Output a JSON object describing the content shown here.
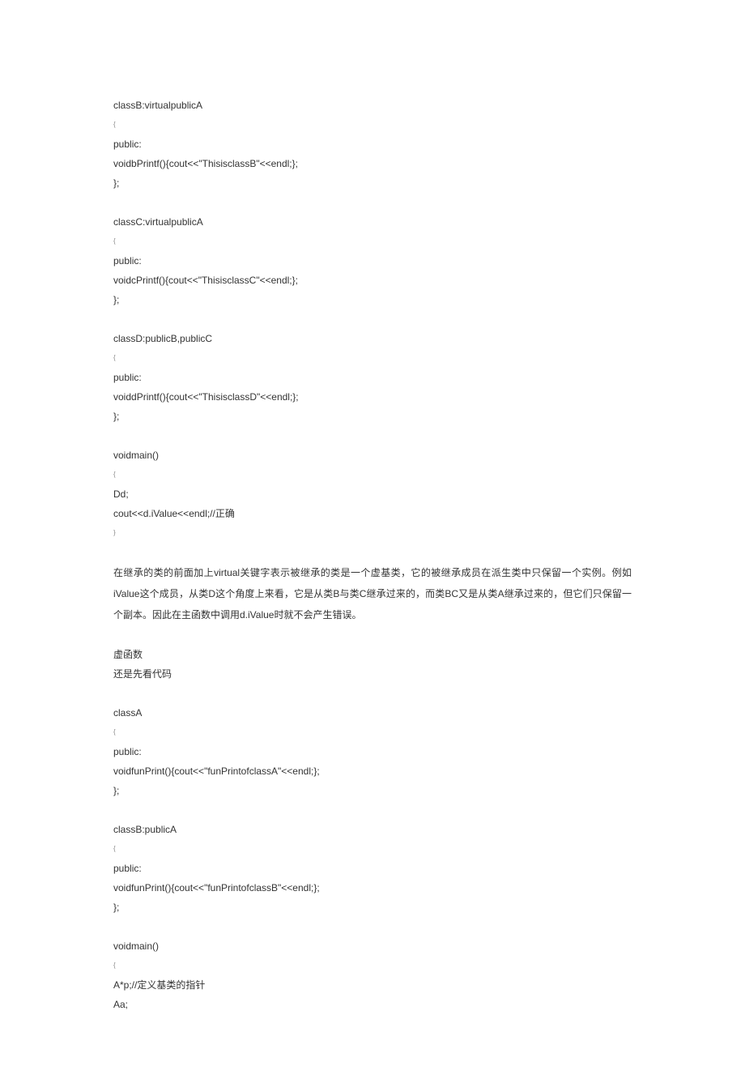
{
  "lines": [
    {
      "t": "code",
      "v": "classB:virtualpublicA"
    },
    {
      "t": "brace",
      "v": "{"
    },
    {
      "t": "code",
      "v": "public:"
    },
    {
      "t": "code",
      "v": "voidbPrintf(){cout<<\"ThisisclassB\"<<endl;};"
    },
    {
      "t": "code",
      "v": "};"
    },
    {
      "t": "gap"
    },
    {
      "t": "code",
      "v": "classC:virtualpublicA"
    },
    {
      "t": "brace",
      "v": "{"
    },
    {
      "t": "code",
      "v": "public:"
    },
    {
      "t": "code",
      "v": "voidcPrintf(){cout<<\"ThisisclassC\"<<endl;};"
    },
    {
      "t": "code",
      "v": "};"
    },
    {
      "t": "gap"
    },
    {
      "t": "code",
      "v": "classD:publicB,publicC"
    },
    {
      "t": "brace",
      "v": "{"
    },
    {
      "t": "code",
      "v": "public:"
    },
    {
      "t": "code",
      "v": "voiddPrintf(){cout<<\"ThisisclassD\"<<endl;};"
    },
    {
      "t": "code",
      "v": "};"
    },
    {
      "t": "gap"
    },
    {
      "t": "code",
      "v": "voidmain()"
    },
    {
      "t": "brace",
      "v": "{"
    },
    {
      "t": "code",
      "v": "Dd;"
    },
    {
      "t": "code",
      "v": "cout<<d.iValue<<endl;//正确"
    },
    {
      "t": "brace",
      "v": "}"
    },
    {
      "t": "gap"
    },
    {
      "t": "para",
      "v": "在继承的类的前面加上virtual关键字表示被继承的类是一个虚基类，它的被继承成员在派生类中只保留一个实例。例如iValue这个成员，从类D这个角度上来看，它是从类B与类C继承过来的，而类BC又是从类A继承过来的，但它们只保留一个副本。因此在主函数中调用d.iValue时就不会产生错误。"
    },
    {
      "t": "gap"
    },
    {
      "t": "code",
      "v": "虚函数"
    },
    {
      "t": "code",
      "v": "还是先看代码"
    },
    {
      "t": "gap"
    },
    {
      "t": "code",
      "v": "classA"
    },
    {
      "t": "brace",
      "v": "{"
    },
    {
      "t": "code",
      "v": "public:"
    },
    {
      "t": "code",
      "v": "voidfunPrint(){cout<<\"funPrintofclassA\"<<endl;};"
    },
    {
      "t": "code",
      "v": "};"
    },
    {
      "t": "gap"
    },
    {
      "t": "code",
      "v": "classB:publicA"
    },
    {
      "t": "brace",
      "v": "{"
    },
    {
      "t": "code",
      "v": "public:"
    },
    {
      "t": "code",
      "v": "voidfunPrint(){cout<<\"funPrintofclassB\"<<endl;};"
    },
    {
      "t": "code",
      "v": "};"
    },
    {
      "t": "gap"
    },
    {
      "t": "code",
      "v": "voidmain()"
    },
    {
      "t": "brace",
      "v": "{"
    },
    {
      "t": "code",
      "v": "A*p;//定义基类的指针"
    },
    {
      "t": "code",
      "v": "Aa;"
    }
  ]
}
